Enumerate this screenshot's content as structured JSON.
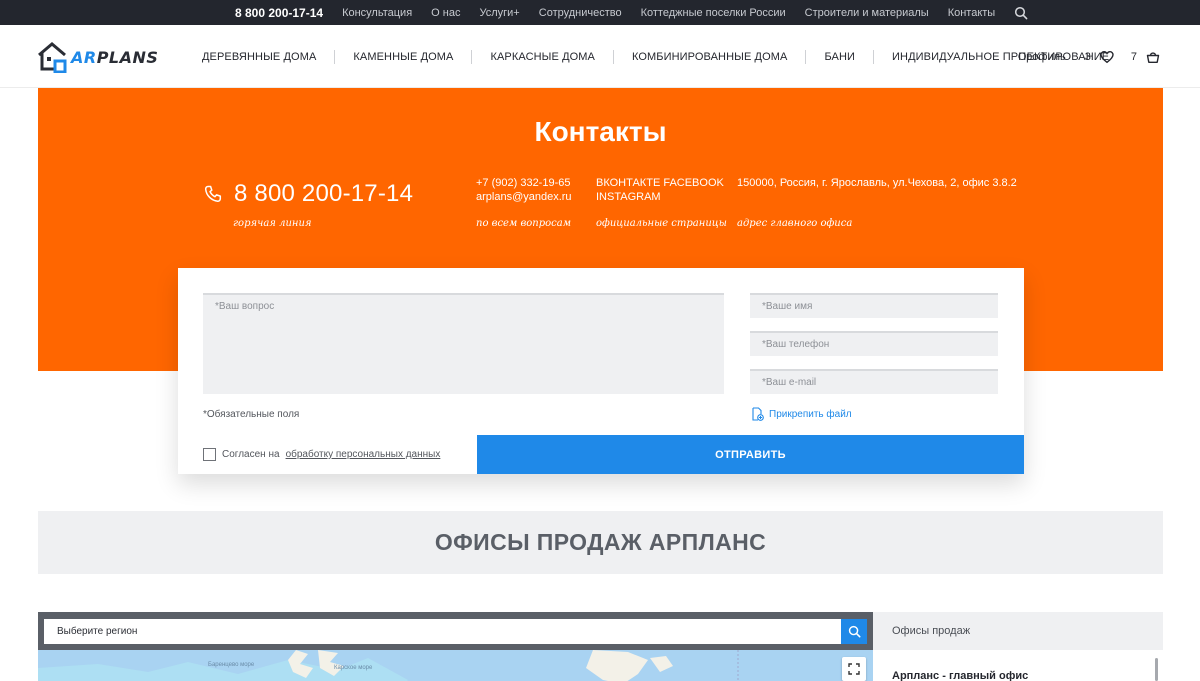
{
  "topbar": {
    "phone": "8 800 200-17-14",
    "links": [
      "Консультация",
      "О нас",
      "Услуги+",
      "Сотрудничество",
      "Коттеджные поселки России",
      "Строители и материалы",
      "Контакты"
    ]
  },
  "header": {
    "logo": {
      "part1": "AR",
      "part2": "PLANS"
    },
    "nav": [
      "ДЕРЕВЯННЫЕ ДОМА",
      "КАМЕННЫЕ ДОМА",
      "КАРКАСНЫЕ ДОМА",
      "КОМБИНИРОВАННЫЕ ДОМА",
      "БАНИ",
      "ИНДИВИДУАЛЬНОЕ ПРОЕКТИРОВАНИЕ"
    ],
    "profile": "Профиль",
    "favorites_count": "3",
    "cart_count": "7"
  },
  "contacts": {
    "title": "Контакты",
    "hotline": {
      "phone": "8 800 200-17-14",
      "label": "горячая линия"
    },
    "general": {
      "phone": "+7 (902) 332-19-65",
      "email": "arplans@yandex.ru",
      "label": "по всем вопросам"
    },
    "social": {
      "line1": "ВКОНТАКТЕ FACEBOOK",
      "line2": "INSTAGRAM",
      "label": "официальные страницы"
    },
    "address": {
      "text": "150000, Россия, г. Ярославль, ул.Чехова, 2, офис 3.8.2",
      "label": "адрес главного офиса"
    }
  },
  "form": {
    "question_placeholder": "*Ваш вопрос",
    "name_placeholder": "*Ваше имя",
    "phone_placeholder": "*Ваш телефон",
    "email_placeholder": "*Ваш e-mail",
    "required_note": "*Обязательные поля",
    "attach_label": "Прикрепить файл",
    "consent_text": "Согласен на",
    "consent_link": "обработку персональных данных",
    "submit": "ОТПРАВИТЬ"
  },
  "offices": {
    "title": "ОФИСЫ ПРОДАЖ АРПЛАНС",
    "region_placeholder": "Выберите регион",
    "map_labels": [
      "Баренцево море",
      "Карское море"
    ],
    "panel_title": "Офисы продаж",
    "first_office": "Арпланс - главный офис"
  },
  "colors": {
    "accent_orange": "#ff6600",
    "accent_blue": "#1f89e8",
    "topbar": "#23262e"
  }
}
